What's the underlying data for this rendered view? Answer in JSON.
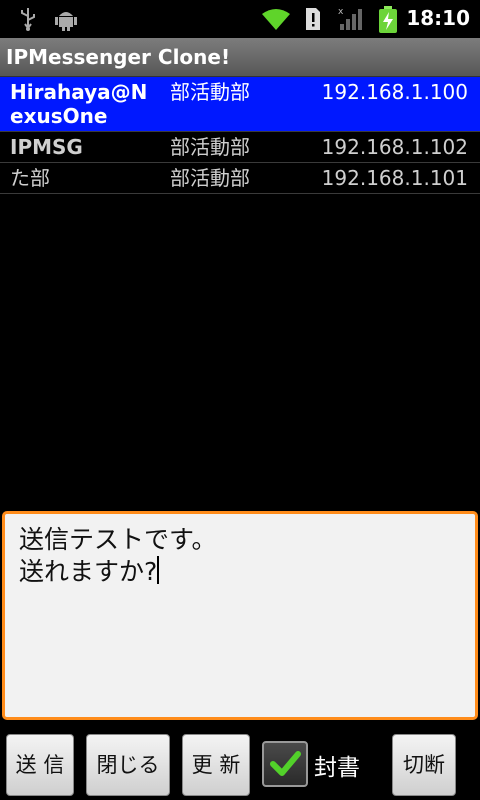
{
  "status_bar": {
    "time": "18:10",
    "icons": [
      "usb-icon",
      "android-debug-icon",
      "wifi-icon",
      "sim-alert-icon",
      "signal-icon",
      "battery-charging-icon"
    ]
  },
  "app": {
    "title": "IPMessenger Clone!"
  },
  "hosts": [
    {
      "name": "Hirahaya@NexusOne",
      "group": "部活動部",
      "ip": "192.168.1.100",
      "selected": true
    },
    {
      "name": "IPMSG",
      "group": "部活動部",
      "ip": "192.168.1.102",
      "selected": false
    },
    {
      "name": "た部",
      "group": "部活動部",
      "ip": "192.168.1.101",
      "selected": false
    }
  ],
  "message": {
    "text": "送信テストです。\n送れますか?"
  },
  "buttons": {
    "send": "送 信",
    "close": "閉じる",
    "refresh": "更 新",
    "sealed": "封書",
    "sealed_checked": true,
    "disconnect": "切断"
  },
  "colors": {
    "selected_row": "#0018ff",
    "focus_border": "#ff8c1a",
    "check": "#52d12a"
  }
}
